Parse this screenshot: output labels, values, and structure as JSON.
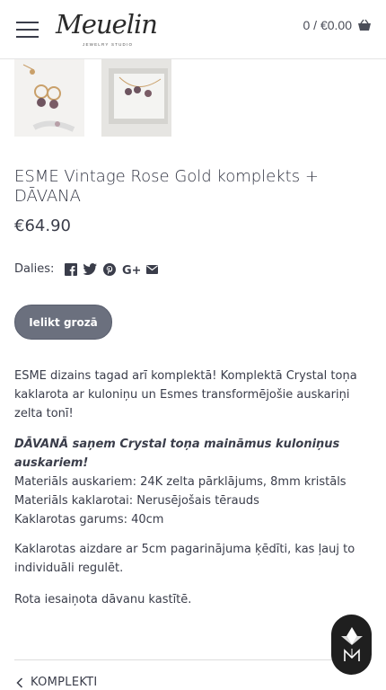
{
  "header": {
    "logo_text": "Meuelin",
    "logo_sub": "JEWELRY STUDIO",
    "cart_text": "0 / €0.00"
  },
  "product": {
    "title": "ESME Vintage Rose Gold komplekts + DĀVANA",
    "price": "€64.90",
    "share_label": "Dalies:",
    "add_to_cart": "Ielikt grozā"
  },
  "description": {
    "intro": "ESME dizains tagad arī komplektā! Komplektā Crystal toņa kaklarota ar kuloniņu un Esmes transformējošie auskariņi zelta tonī!",
    "gift": "DĀVANĀ saņem Crystal toņa maināmus kuloniņus auskariem!",
    "material_earrings": "Materiāls auskariem: 24K zelta pārklājums, 8mm kristāls",
    "material_necklace": "Materiāls kaklarotai: Nerusējošais tērauds",
    "necklace_length": "Kaklarotas garums: 40cm",
    "clasp": "Kaklarotas aizdare ar 5cm pagarinājuma ķēdīti, kas ļauj to individuāli regulēt.",
    "packaging": "Rota iesaiņota dāvanu kastītē."
  },
  "nav": {
    "back_label": "KOMPLEKTI"
  },
  "icons": {
    "menu": "hamburger-menu-icon",
    "cart": "shopping-basket-icon",
    "share": [
      "facebook-icon",
      "twitter-icon",
      "pinterest-icon",
      "google-plus-icon",
      "email-icon"
    ],
    "back": "chevron-left-icon",
    "badge": "brand-badge-icon"
  },
  "colors": {
    "text": "#3a3d4a",
    "button_bg": "#6b707e",
    "badge_bg": "#1f1f1f"
  }
}
